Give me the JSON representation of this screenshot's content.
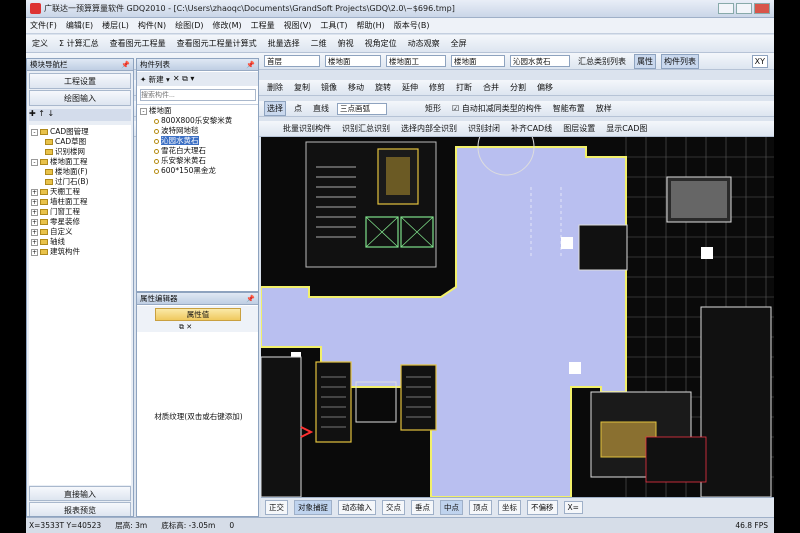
{
  "titlebar": {
    "title": "广联达一预算算量软件 GDQ2010 - [C:\\Users\\zhaoqc\\Documents\\GrandSoft Projects\\GDQ\\2.0\\~$696.tmp]"
  },
  "menubar": {
    "items": [
      "文件(F)",
      "编辑(E)",
      "楼层(L)",
      "构件(N)",
      "绘图(D)",
      "修改(M)",
      "工程量",
      "视图(V)",
      "工具(T)",
      "帮助(H)",
      "版本号(B)"
    ]
  },
  "toolbar1": {
    "items": [
      "定义",
      "Σ 计算汇总",
      "查看图元工程量",
      "查看图元工程量计算式",
      "批量选择",
      "二维",
      "俯视",
      "视角定位",
      "动态观察",
      "全屏"
    ]
  },
  "toolbar2": {
    "floor": "首层",
    "category": "楼地面",
    "subcategory": "楼地面工",
    "select": "楼地面",
    "component": "沁园水黄石",
    "items": [
      "属性",
      "构件列表"
    ],
    "summary": "汇总类别列表",
    "xy": "XY"
  },
  "toolbar3": {
    "items": [
      "删除",
      "复制",
      "镜像",
      "移动",
      "旋转",
      "延伸",
      "修剪",
      "打断",
      "合并",
      "分割",
      "偏移"
    ]
  },
  "toolbar4": {
    "select": "选择",
    "point": "点",
    "line": "直线",
    "arc": "三点画弧",
    "rect": "矩形",
    "auto": "自动扣减同类型的构件",
    "smart": "智能布置",
    "lay": "放样"
  },
  "toolbar5": {
    "items": [
      "批量识别构件",
      "识别汇总识别",
      "选择内部全识别",
      "识别封闭",
      "补齐CAD线",
      "图层设置",
      "显示CAD图"
    ]
  },
  "nav": {
    "title": "模块导航栏",
    "btn1": "工程设置",
    "btn2": "绘图输入",
    "tree": [
      {
        "label": "CAD图管理",
        "level": 0,
        "exp": "-"
      },
      {
        "label": "CAD草图",
        "level": 1
      },
      {
        "label": "识别楼网",
        "level": 1
      },
      {
        "label": "楼地面工程",
        "level": 0,
        "exp": "-"
      },
      {
        "label": "楼地面(F)",
        "level": 1
      },
      {
        "label": "过门石(B)",
        "level": 1
      },
      {
        "label": "天棚工程",
        "level": 0,
        "exp": "+"
      },
      {
        "label": "墙柱面工程",
        "level": 0,
        "exp": "+"
      },
      {
        "label": "门窗工程",
        "level": 0,
        "exp": "+"
      },
      {
        "label": "零星装修",
        "level": 0,
        "exp": "+"
      },
      {
        "label": "自定义",
        "level": 0,
        "exp": "+"
      },
      {
        "label": "轴线",
        "level": 0,
        "exp": "+"
      },
      {
        "label": "建筑构件",
        "level": 0,
        "exp": "+"
      }
    ],
    "bottom1": "直接输入",
    "bottom2": "报表预览"
  },
  "components": {
    "title": "构件列表",
    "new": "新建",
    "search_placeholder": "搜索构件...",
    "root": "楼地面",
    "items": [
      "800X800乐安黎米黄",
      "波特网地毯",
      "沁园水黄石",
      "雪花白大理石",
      "乐安黎米黄石",
      "600*150黑金龙"
    ],
    "selected": 2
  },
  "props": {
    "title": "属性编辑器",
    "tab": "属性值",
    "hint": "材质纹理(双击或右键添加)"
  },
  "snap": {
    "items": [
      "正交",
      "对象捕捉",
      "动态输入",
      "交点",
      "垂点",
      "中点",
      "顶点",
      "坐标",
      "不偏移",
      "X="
    ]
  },
  "status": {
    "coords": "X=3533T  Y=40523",
    "floor_height": "层高: 3m",
    "floor_elev": "底标高: -3.05m",
    "zero": "0",
    "fps": "46.8 FPS"
  },
  "colors": {
    "accent": "#bfd3ee",
    "selected_bg": "#3b6fc4",
    "cad_fill": "#b9bff0"
  }
}
